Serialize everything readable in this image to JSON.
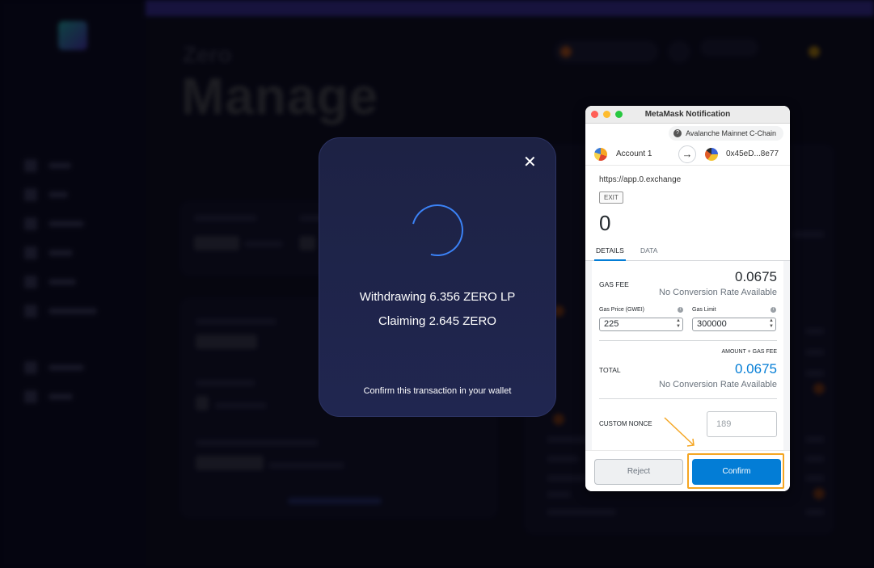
{
  "background": {
    "brand_small": "Zero",
    "page_title": "Manage"
  },
  "modal": {
    "line1": "Withdrawing 6.356 ZERO LP",
    "line2": "Claiming 2.645 ZERO",
    "footer": "Confirm this transaction in your wallet",
    "close_icon": "close-icon"
  },
  "metamask": {
    "window_title": "MetaMask Notification",
    "network": "Avalanche Mainnet C-Chain",
    "from_account": "Account 1",
    "to_address": "0x45eD...8e77",
    "origin": "https://app.0.exchange",
    "exit_label": "EXIT",
    "amount": "0",
    "tabs": [
      "DETAILS",
      "DATA"
    ],
    "gas_fee_label": "GAS FEE",
    "gas_fee_value": "0.0675",
    "gas_fee_conversion": "No Conversion Rate Available",
    "gas_price_label": "Gas Price (GWEI)",
    "gas_price_value": "225",
    "gas_limit_label": "Gas Limit",
    "gas_limit_value": "300000",
    "amount_gas_fee_label": "AMOUNT + GAS FEE",
    "total_label": "TOTAL",
    "total_value": "0.0675",
    "total_conversion": "No Conversion Rate Available",
    "custom_nonce_label": "CUSTOM NONCE",
    "custom_nonce_placeholder": "189",
    "reject_label": "Reject",
    "confirm_label": "Confirm"
  },
  "colors": {
    "accent": "#037dd6",
    "highlight": "#f5a623",
    "modal_bg": "#1f2449"
  }
}
